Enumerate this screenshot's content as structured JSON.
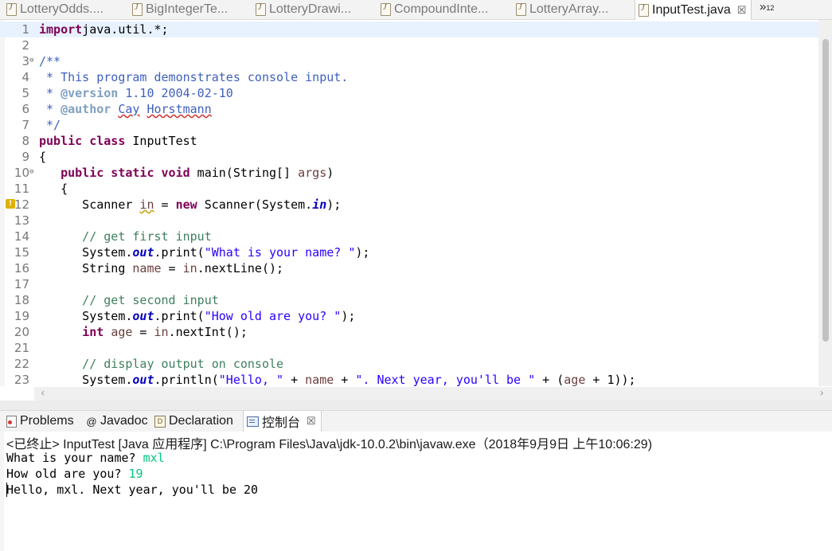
{
  "editor_tabs": [
    {
      "label": "LotteryOdds....",
      "active": false
    },
    {
      "label": "BigIntegerTe...",
      "active": false
    },
    {
      "label": "LotteryDrawi...",
      "active": false
    },
    {
      "label": "CompoundInte...",
      "active": false
    },
    {
      "label": "LotteryArray...",
      "active": false
    },
    {
      "label": "InputTest.java",
      "active": true,
      "close": "☒"
    }
  ],
  "tab_overflow": {
    "symbol": "»",
    "count": "12"
  },
  "code_lines": [
    {
      "n": "1",
      "parts": [
        [
          "kw",
          "import"
        ],
        [
          "",
          "java.util.*;"
        ]
      ]
    },
    {
      "n": "2",
      "parts": []
    },
    {
      "n": "3",
      "fold": "⊖",
      "parts": [
        [
          "jd",
          "/**"
        ]
      ]
    },
    {
      "n": "4",
      "parts": [
        [
          "jd",
          " * This program demonstrates console input."
        ]
      ]
    },
    {
      "n": "5",
      "parts": [
        [
          "jd",
          " * "
        ],
        [
          "jdtag",
          "@version"
        ],
        [
          "jd",
          " 1.10 2004-02-10"
        ]
      ]
    },
    {
      "n": "6",
      "parts": [
        [
          "jd",
          " * "
        ],
        [
          "jdtag",
          "@author"
        ],
        [
          "jd",
          " "
        ],
        [
          "jd squig-red",
          "Cay"
        ],
        [
          "jd",
          " "
        ],
        [
          "jd squig-red",
          "Horstmann"
        ]
      ]
    },
    {
      "n": "7",
      "parts": [
        [
          "jd",
          " */"
        ]
      ]
    },
    {
      "n": "8",
      "parts": [
        [
          "kw",
          "public class"
        ],
        [
          "",
          " InputTest"
        ]
      ]
    },
    {
      "n": "9",
      "parts": [
        [
          "",
          "{"
        ]
      ]
    },
    {
      "n": "10",
      "fold": "⊖",
      "parts": [
        [
          "",
          "   "
        ],
        [
          "kw",
          "public static void"
        ],
        [
          "",
          " main(String[] "
        ],
        [
          "var",
          "args"
        ],
        [
          "",
          ")"
        ]
      ]
    },
    {
      "n": "11",
      "parts": [
        [
          "",
          "   {"
        ]
      ]
    },
    {
      "n": "12",
      "warn": true,
      "parts": [
        [
          "",
          "      Scanner "
        ],
        [
          "var squig",
          "in"
        ],
        [
          "",
          " = "
        ],
        [
          "kw",
          "new"
        ],
        [
          "",
          " Scanner(System."
        ],
        [
          "fld",
          "in"
        ],
        [
          "",
          ");"
        ]
      ]
    },
    {
      "n": "13",
      "parts": []
    },
    {
      "n": "14",
      "parts": [
        [
          "cm",
          "      // get first input"
        ]
      ]
    },
    {
      "n": "15",
      "parts": [
        [
          "",
          "      System."
        ],
        [
          "fld",
          "out"
        ],
        [
          "",
          ".print("
        ],
        [
          "str",
          "\"What is your name? \""
        ],
        [
          "",
          ");"
        ]
      ]
    },
    {
      "n": "16",
      "parts": [
        [
          "",
          "      String "
        ],
        [
          "var",
          "name"
        ],
        [
          "",
          " = "
        ],
        [
          "var",
          "in"
        ],
        [
          "",
          ".nextLine();"
        ]
      ]
    },
    {
      "n": "17",
      "parts": []
    },
    {
      "n": "18",
      "parts": [
        [
          "cm",
          "      // get second input"
        ]
      ]
    },
    {
      "n": "19",
      "parts": [
        [
          "",
          "      System."
        ],
        [
          "fld",
          "out"
        ],
        [
          "",
          ".print("
        ],
        [
          "str",
          "\"How old are you? \""
        ],
        [
          "",
          ");"
        ]
      ]
    },
    {
      "n": "20",
      "parts": [
        [
          "",
          "      "
        ],
        [
          "kw",
          "int"
        ],
        [
          "",
          " "
        ],
        [
          "var",
          "age"
        ],
        [
          "",
          " = "
        ],
        [
          "var",
          "in"
        ],
        [
          "",
          ".nextInt();"
        ]
      ]
    },
    {
      "n": "21",
      "parts": []
    },
    {
      "n": "22",
      "parts": [
        [
          "cm",
          "      // display output on console"
        ]
      ]
    },
    {
      "n": "23",
      "parts": [
        [
          "",
          "      System."
        ],
        [
          "fld",
          "out"
        ],
        [
          "",
          ".println("
        ],
        [
          "str",
          "\"Hello, \""
        ],
        [
          "",
          " + "
        ],
        [
          "var",
          "name"
        ],
        [
          "",
          " + "
        ],
        [
          "str",
          "\". Next year, you'll be \""
        ],
        [
          "",
          " + ("
        ],
        [
          "var",
          "age"
        ],
        [
          "",
          " + 1));"
        ]
      ]
    }
  ],
  "view_tabs": [
    {
      "label": "Problems",
      "icon": "problems-icon",
      "active": false
    },
    {
      "label": "Javadoc",
      "icon": "at-icon",
      "glyph": "@",
      "active": false
    },
    {
      "label": "Declaration",
      "icon": "declaration-icon",
      "glyph": "D",
      "active": false
    },
    {
      "label": "控制台",
      "icon": "console-icon",
      "active": true,
      "close": "☒"
    }
  ],
  "console": {
    "status": "<已终止> InputTest [Java 应用程序] C:\\Program Files\\Java\\jdk-10.0.2\\bin\\javaw.exe（2018年9月9日 上午10:06:29)",
    "lines": [
      {
        "prompt": "What is your name? ",
        "input": "mxl"
      },
      {
        "prompt": "How old are you? ",
        "input": "19"
      },
      {
        "prompt": "Hello, mxl. Next year, you'll be 20",
        "input": ""
      }
    ]
  },
  "scroll_arrows": {
    "left": "‹",
    "right": "›"
  }
}
